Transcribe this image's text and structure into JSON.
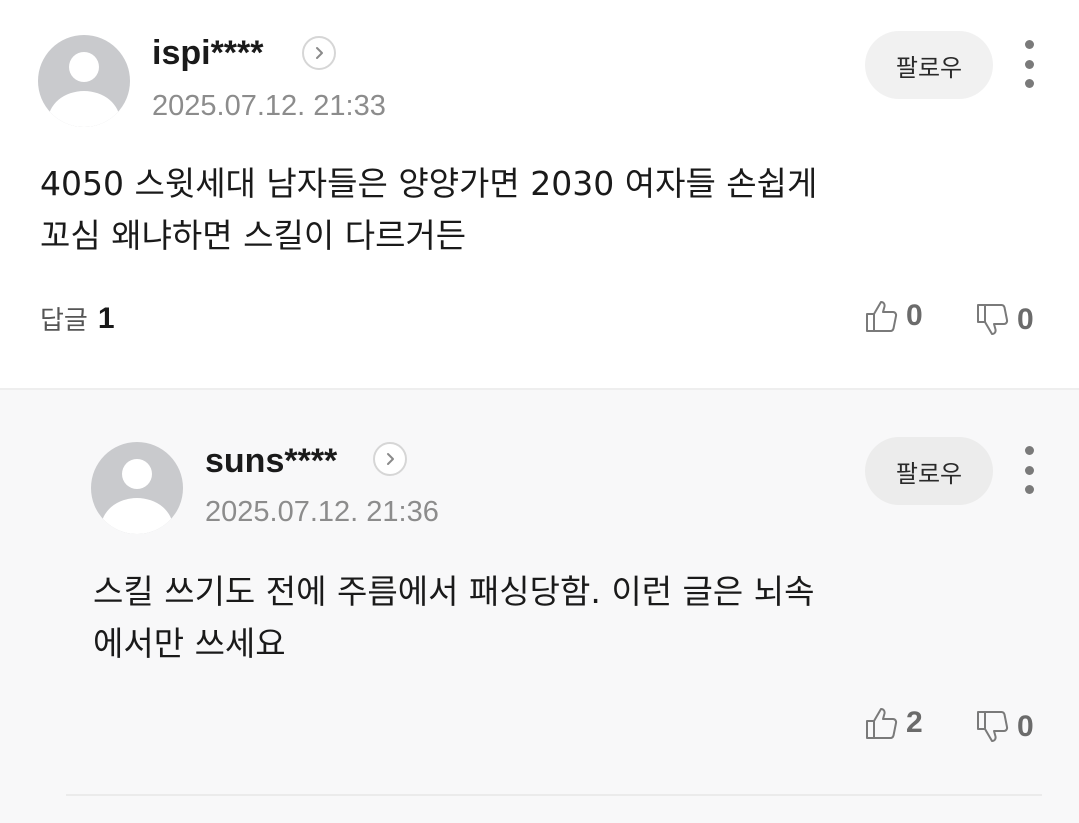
{
  "comments": [
    {
      "nickname": "ispi****",
      "date": "2025.07.12. 21:33",
      "follow_label": "팔로우",
      "content_line1": "4050 스윗세대 남자들은 양양가면 2030 여자들 손쉽게",
      "content_line2": "꼬심 왜냐하면 스킬이 다르거든",
      "replies_label": "답글",
      "replies_count": "1",
      "likes": "0",
      "dislikes": "0"
    },
    {
      "nickname": "suns****",
      "date": "2025.07.12. 21:36",
      "follow_label": "팔로우",
      "content_line1": "스킬 쓰기도 전에 주름에서 패싱당함. 이런 글은 뇌속",
      "content_line2": "에서만 쓰세요",
      "likes": "2",
      "dislikes": "0"
    }
  ],
  "icons": {
    "avatar": "default-avatar-icon",
    "profile_link": "chevron-right-icon",
    "more": "more-vertical-icon",
    "like": "thumbs-up-icon",
    "dislike": "thumbs-down-icon"
  },
  "colors": {
    "avatar_bg": "#c9cacd",
    "date_text": "#8c8c8c",
    "follow_bg": "#f1f1f1",
    "reply_bg": "#f8f8f9"
  }
}
